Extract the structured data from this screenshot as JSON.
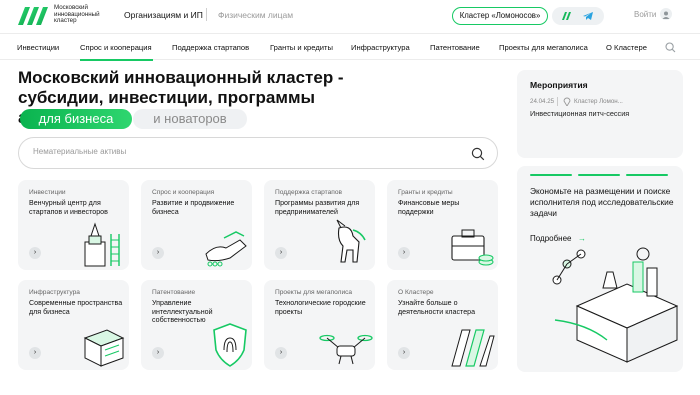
{
  "header": {
    "logo_lines": [
      "Московский",
      "инновационный",
      "кластер"
    ],
    "tab_org": "Организациям и ИП",
    "tab_phys": "Физическим лицам",
    "cluster_button": "Кластер «Ломоносов»",
    "login": "Войти"
  },
  "nav": {
    "items": [
      "Инвестиции",
      "Спрос и кооперация",
      "Поддержка стартапов",
      "Гранты и кредиты",
      "Инфраструктура",
      "Патентование",
      "Проекты для мегаполиса",
      "О Кластере"
    ]
  },
  "hero": {
    "title": "Московский инновационный кластер - субсидии, инвестиции, программы акселерации",
    "pill_business": "для бизнеса",
    "pill_innovators": "и новаторов"
  },
  "search": {
    "placeholder": "Нематериальные активы"
  },
  "cards": [
    {
      "category": "Инвестиции",
      "title": "Венчурный центр для стартапов и инвесторов"
    },
    {
      "category": "Спрос и кооперация",
      "title": "Развитие и продвижение бизнеса"
    },
    {
      "category": "Поддержка стартапов",
      "title": "Программы развития для предпринимателей"
    },
    {
      "category": "Гранты и кредиты",
      "title": "Финансовые меры поддержки"
    },
    {
      "category": "Инфраструктура",
      "title": "Современные пространства для бизнеса"
    },
    {
      "category": "Патентование",
      "title": "Управление интеллектуальной собственностью"
    },
    {
      "category": "Проекты для мегаполиса",
      "title": "Технологические городские проекты"
    },
    {
      "category": "О Кластере",
      "title": "Узнайте больше о деятельности кластера"
    }
  ],
  "events": {
    "title": "Мероприятия",
    "date": "24.04.25",
    "place": "Кластер Ломон...",
    "name": "Инвестиционная питч-сессия"
  },
  "promo": {
    "text": "Экономьте на размещении и поиске исполнителя под исследовательские задачи",
    "more": "Подробнее",
    "arrow": "→"
  },
  "card_arrow": "›",
  "colors": {
    "accent": "#17c964",
    "card_bg": "#f4f5f6",
    "text": "#111111",
    "muted": "#888888"
  }
}
